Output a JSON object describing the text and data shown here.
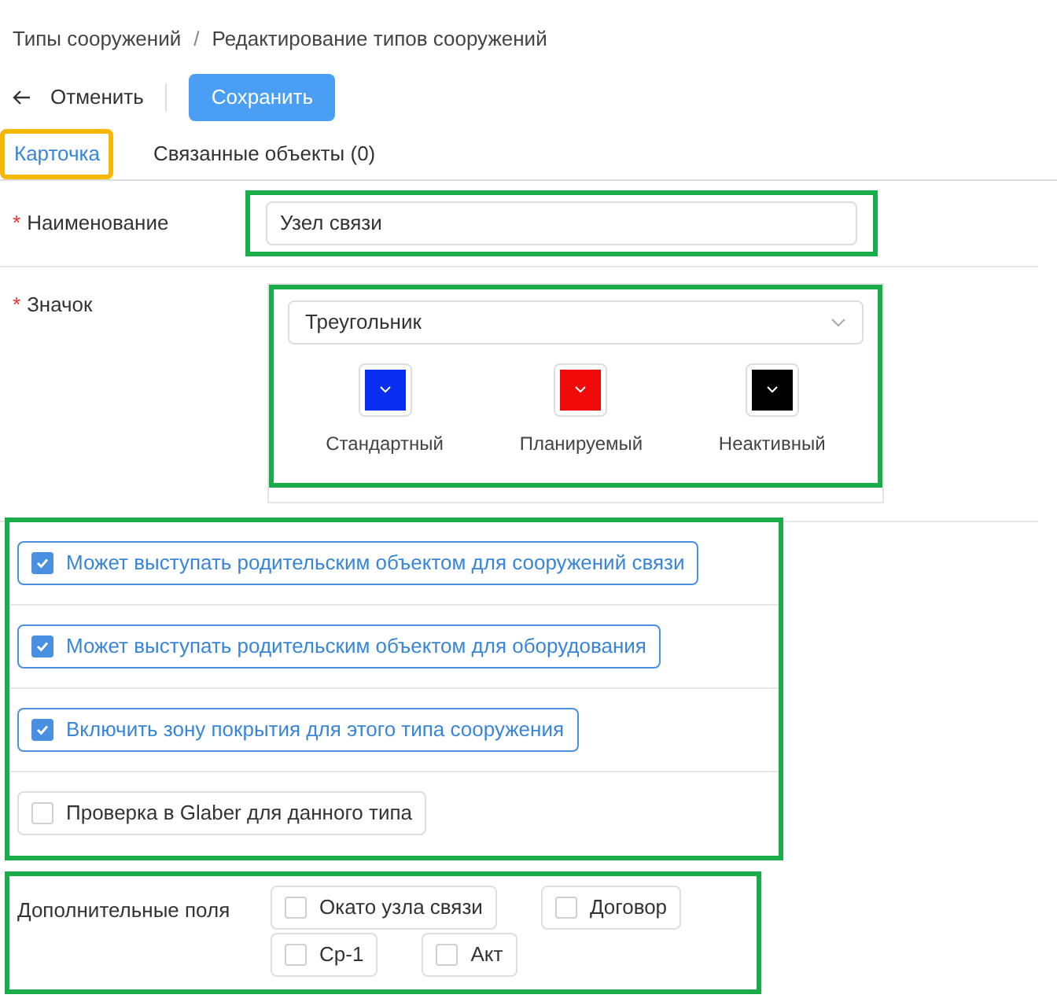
{
  "breadcrumbs": [
    "Типы сооружений",
    "Редактирование типов сооружений"
  ],
  "separator": "/",
  "toolbar": {
    "cancel": "Отменить",
    "save": "Сохранить"
  },
  "tabs": [
    {
      "label": "Карточка",
      "selected": true,
      "highlight": true
    },
    {
      "label": "Связанные объекты (0)",
      "selected": false,
      "highlight": false
    }
  ],
  "required_mark": "*",
  "name_field": {
    "label": "Наименование",
    "required": true,
    "value": "Узел связи",
    "highlight": true
  },
  "icon_field": {
    "label": "Значок",
    "required": true,
    "value": "Треугольник",
    "highlight": true,
    "colors": [
      {
        "label": "Стандартный",
        "color": "#0a2ef0"
      },
      {
        "label": "Планируемый",
        "color": "#f00a0a"
      },
      {
        "label": "Неактивный",
        "color": "#000000"
      }
    ]
  },
  "options": {
    "highlight": true,
    "items": [
      {
        "label": "Может выступать родительским объектом для сооружений связи",
        "checked": true
      },
      {
        "label": "Может выступать родительским объектом для оборудования",
        "checked": true
      },
      {
        "label": "Включить зону покрытия для этого типа сооружения",
        "checked": true
      },
      {
        "label": "Проверка в Glaber для данного типа",
        "checked": false
      }
    ]
  },
  "extra_fields": {
    "label": "Дополнительные поля",
    "highlight": true,
    "items": [
      {
        "label": "Окато узла связи",
        "checked": false
      },
      {
        "label": "Договор",
        "checked": false
      },
      {
        "label": "Ср-1",
        "checked": false
      },
      {
        "label": "Акт",
        "checked": false
      }
    ]
  }
}
